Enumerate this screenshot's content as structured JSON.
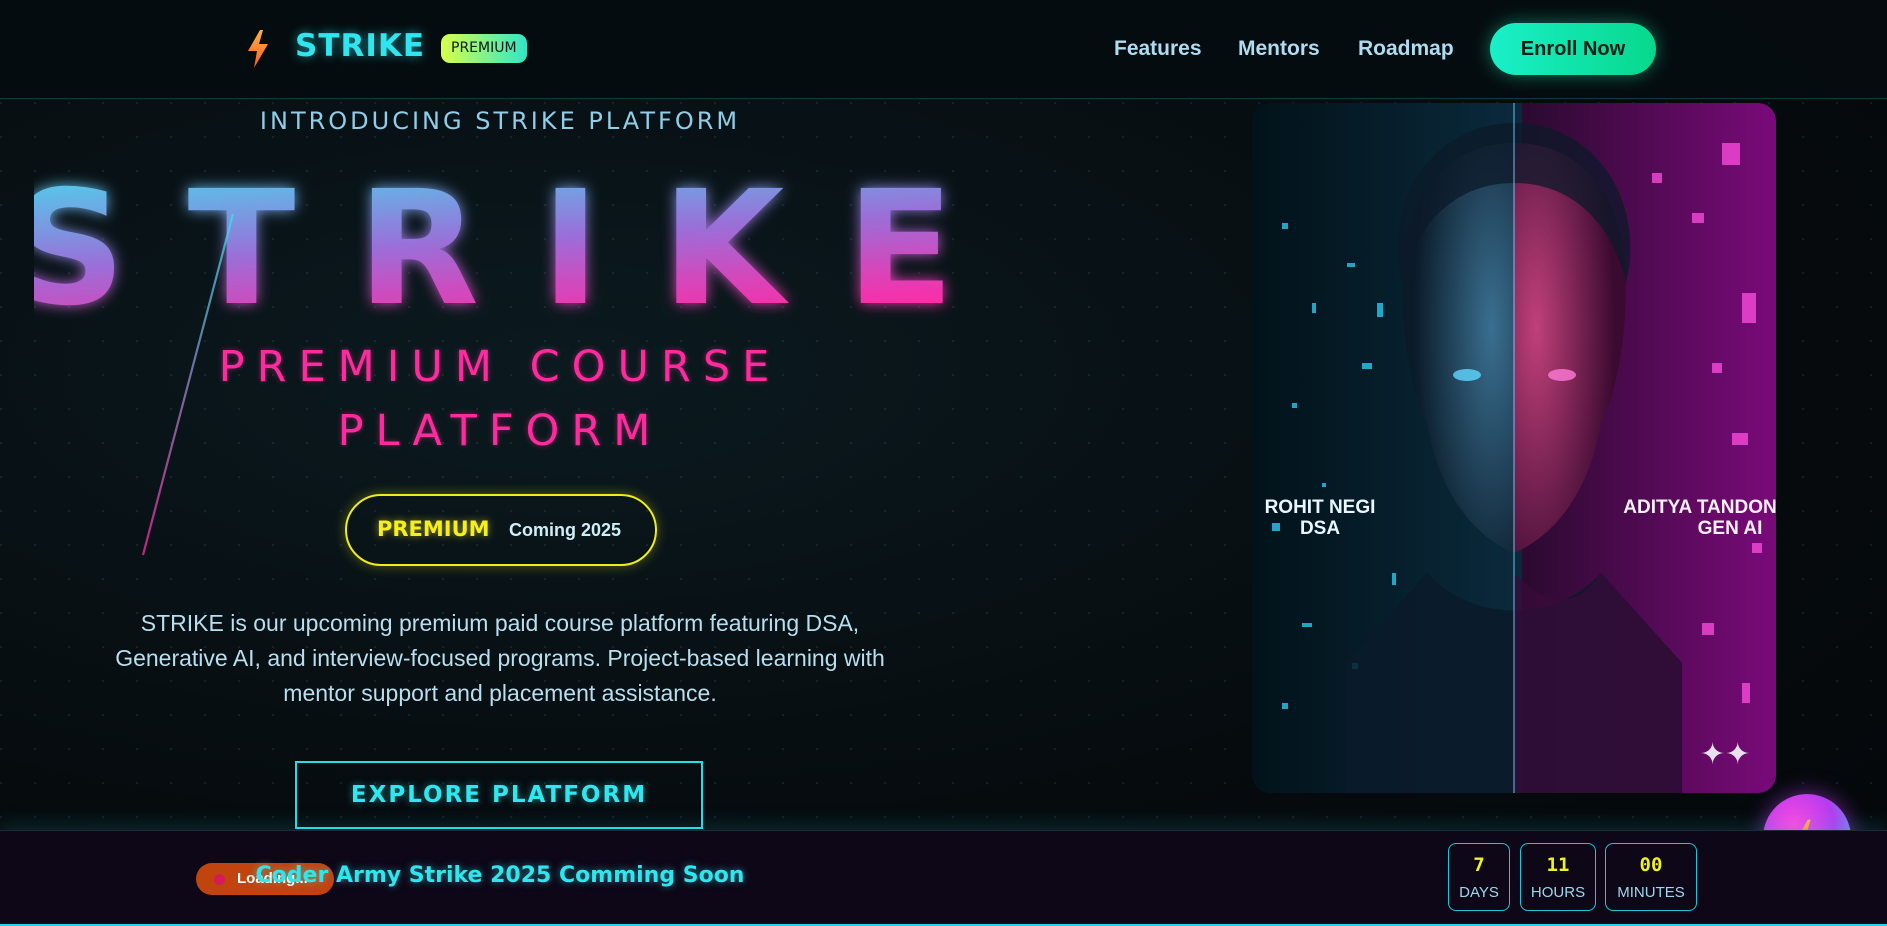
{
  "header": {
    "brand": "STRIKE",
    "badge": "PREMIUM",
    "nav": [
      "Features",
      "Mentors",
      "Roadmap"
    ],
    "cta": "Enroll Now"
  },
  "hero": {
    "eyebrow": "INTRODUCING STRIKE PLATFORM",
    "headline": "STRIKE",
    "subtitle_line1": "PREMIUM COURSE",
    "subtitle_line2": "PLATFORM",
    "pill_premium": "PREMIUM",
    "pill_coming": "Coming 2025",
    "description": "STRIKE is our upcoming premium paid course platform featuring DSA, Generative AI, and interview-focused programs. Project-based learning with mentor support and placement assistance.",
    "button": "EXPLORE PLATFORM"
  },
  "portrait": {
    "left_name": "ROHIT NEGI",
    "left_topic": "DSA",
    "right_name": "ADITYA TANDON",
    "right_topic": "GEN AI"
  },
  "footer": {
    "loading": "Loading...",
    "announcement": "Coder Army Strike 2025 Comming Soon",
    "countdown": [
      {
        "value": "7",
        "label": "DAYS"
      },
      {
        "value": "11",
        "label": "HOURS"
      },
      {
        "value": "00",
        "label": "MINUTES"
      }
    ]
  },
  "colors": {
    "cyan": "#2fe6ef",
    "magenta": "#ff2a9e",
    "yellow": "#f2ec1a",
    "green": "#19f0c8"
  }
}
